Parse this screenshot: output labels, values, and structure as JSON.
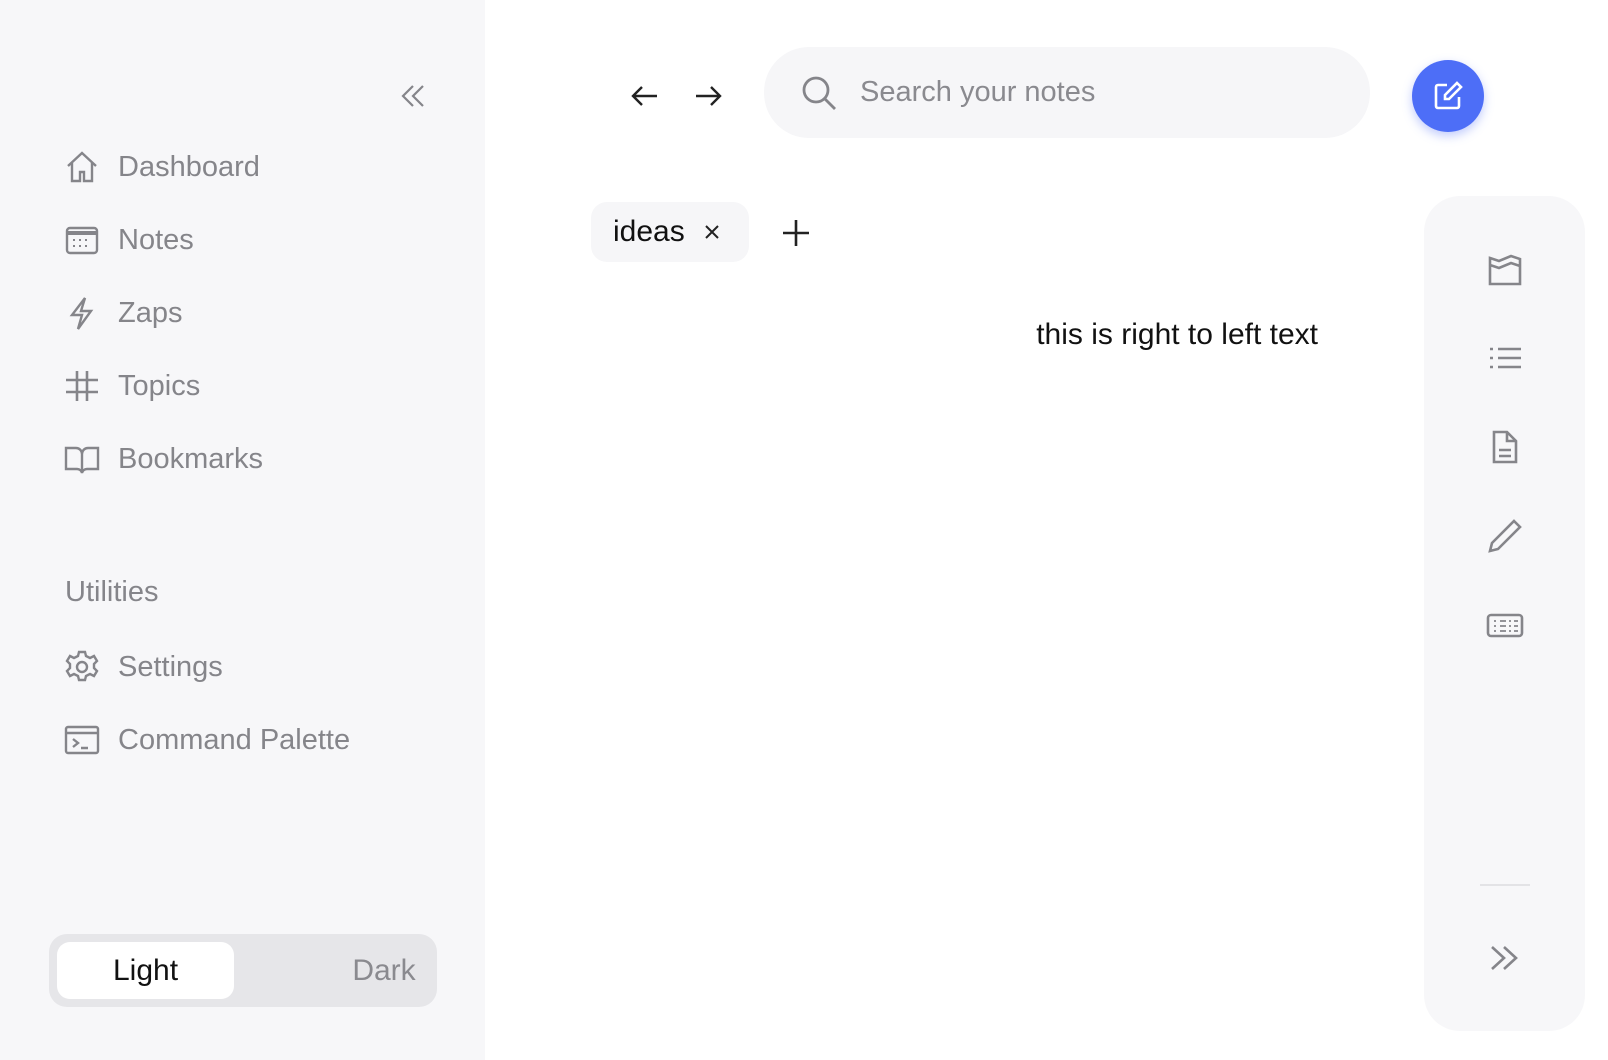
{
  "sidebar": {
    "items": [
      {
        "label": "Dashboard",
        "icon": "home-icon"
      },
      {
        "label": "Notes",
        "icon": "calendar-icon"
      },
      {
        "label": "Zaps",
        "icon": "lightning-icon"
      },
      {
        "label": "Topics",
        "icon": "hash-icon"
      },
      {
        "label": "Bookmarks",
        "icon": "book-icon"
      }
    ],
    "section_title": "Utilities",
    "utilities": [
      {
        "label": "Settings",
        "icon": "gear-icon"
      },
      {
        "label": "Command Palette",
        "icon": "terminal-icon"
      }
    ],
    "theme": {
      "light": "Light",
      "dark": "Dark",
      "selected": "Light"
    }
  },
  "search": {
    "placeholder": "Search your notes",
    "value": ""
  },
  "tags": [
    {
      "label": "ideas"
    }
  ],
  "note": {
    "text": "this is right to left text"
  },
  "accent": "#4d6ef7"
}
